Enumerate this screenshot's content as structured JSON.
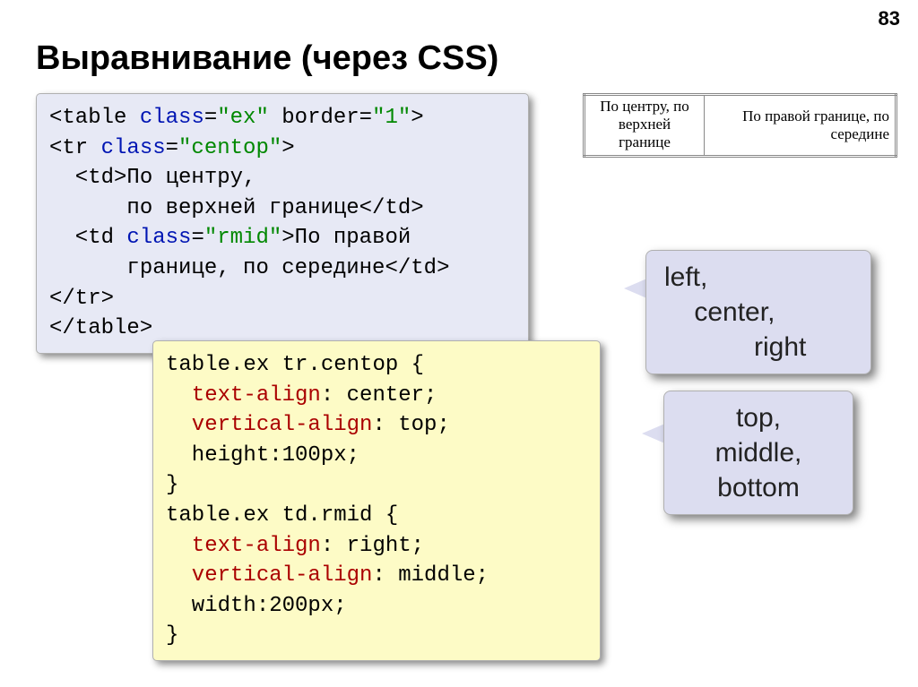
{
  "page_number": "83",
  "title": "Выравнивание (через CSS)",
  "html_code": {
    "l1_a": "<table ",
    "l1_kw": "class",
    "l1_b": "=",
    "l1_str": "\"ex\"",
    "l1_c": " border=",
    "l1_str2": "\"1\"",
    "l1_d": ">",
    "l2_a": "<tr ",
    "l2_kw": "class",
    "l2_b": "=",
    "l2_str": "\"centop\"",
    "l2_c": ">",
    "l3": "  <td>По центру,",
    "l4": "      по верхней границе</td>",
    "l5_a": "  <td ",
    "l5_kw": "class",
    "l5_b": "=",
    "l5_str": "\"rmid\"",
    "l5_c": ">По правой",
    "l6": "      границе, по середине</td>",
    "l7": "</tr>",
    "l8": "</table>"
  },
  "css_code": {
    "l1": "table.ex tr.centop {",
    "l2_p": "  text-align",
    "l2_v": ": center;",
    "l3_p": "  vertical-align",
    "l3_v": ": top;",
    "l4": "  height:100px;",
    "l5": "}",
    "l6": "table.ex td.rmid {",
    "l7_p": "  text-align",
    "l7_v": ": right;",
    "l8_p": "  vertical-align",
    "l8_v": ": middle;",
    "l9": "  width:200px;",
    "l10": "}"
  },
  "callouts": {
    "text_align_values": "left,\n    center,\n            right",
    "vertical_align_values": "top,\nmiddle,\nbottom"
  },
  "example_table": {
    "cell1": "По центру, по\nверхней\nгранице",
    "cell2": "По правой границе, по\nсередине"
  }
}
